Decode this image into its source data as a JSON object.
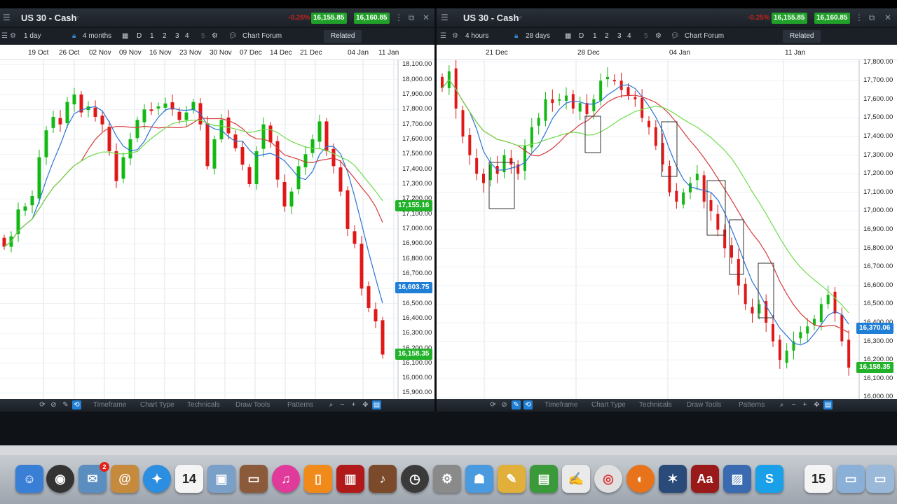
{
  "colors": {
    "bull": "#14b814",
    "bear": "#e01818",
    "ma_blue": "#2a74d6",
    "ma_red": "#d63a3a",
    "ma_green": "#6fdc4a",
    "badge_green": "#22b22a",
    "badge_blue": "#1f7fd6"
  },
  "left": {
    "title": "US 30 - Cash",
    "quote_change": "-0.26%",
    "quote_sell": "16,155.85",
    "quote_buy": "16,160.85",
    "toolbar": {
      "interval": "1 day",
      "range": "4 months",
      "zoom": [
        "D",
        "1",
        "2",
        "3",
        "4",
        "5"
      ],
      "forum": "Chart Forum",
      "related": "Related"
    },
    "dates": [
      "19 Oct",
      "26 Oct",
      "02 Nov",
      "09 Nov",
      "16 Nov",
      "23 Nov",
      "30 Nov",
      "07 Dec",
      "14 Dec",
      "21 Dec",
      "04 Jan",
      "11 Jan"
    ],
    "yticks": [
      "18,100.00",
      "18,000.00",
      "17,900.00",
      "17,800.00",
      "17,700.00",
      "17,600.00",
      "17,500.00",
      "17,400.00",
      "17,300.00",
      "17,200.00",
      "17,100.00",
      "17,000.00",
      "16,900.00",
      "16,800.00",
      "16,700.00",
      "16,600.00",
      "16,500.00",
      "16,400.00",
      "16,300.00",
      "16,200.00",
      "16,100.00",
      "16,000.00",
      "15,900.00"
    ],
    "badges": [
      {
        "label": "17,155.16",
        "value": 17155.16,
        "color": "green"
      },
      {
        "label": "16,603.75",
        "value": 16603.75,
        "color": "blue"
      },
      {
        "label": "16,158.35",
        "value": 16158.35,
        "color": "green"
      }
    ],
    "bottom": [
      "Timeframe",
      "Chart Type",
      "Technicals",
      "Draw Tools",
      "Patterns"
    ]
  },
  "right": {
    "title": "US 30 - Cash",
    "quote_change": "-0.25%",
    "quote_sell": "16,155.85",
    "quote_buy": "16,160.85",
    "toolbar": {
      "interval": "4 hours",
      "range": "28 days",
      "zoom": [
        "D",
        "1",
        "2",
        "3",
        "4",
        "5"
      ],
      "forum": "Chart Forum",
      "related": "Related"
    },
    "dates": [
      "21 Dec",
      "28 Dec",
      "04 Jan",
      "11 Jan"
    ],
    "yticks": [
      "17,800.00",
      "17,700.00",
      "17,600.00",
      "17,500.00",
      "17,400.00",
      "17,300.00",
      "17,200.00",
      "17,100.00",
      "17,000.00",
      "16,900.00",
      "16,800.00",
      "16,700.00",
      "16,600.00",
      "16,500.00",
      "16,400.00",
      "16,300.00",
      "16,200.00",
      "16,100.00",
      "16,000.00"
    ],
    "badges": [
      {
        "label": "16,370.06",
        "value": 16370.06,
        "color": "blue"
      },
      {
        "label": "16,158.35",
        "value": 16158.35,
        "color": "green"
      }
    ],
    "bottom": [
      "Timeframe",
      "Chart Type",
      "Technicals",
      "Draw Tools",
      "Patterns"
    ]
  },
  "chart_data": [
    {
      "type": "candlestick",
      "title": "US 30 - Cash",
      "interval": "1 day",
      "ylim": [
        15860,
        18130
      ],
      "x_labels": [
        "19 Oct",
        "26 Oct",
        "02 Nov",
        "09 Nov",
        "16 Nov",
        "23 Nov",
        "30 Nov",
        "07 Dec",
        "14 Dec",
        "21 Dec",
        "04 Jan",
        "11 Jan"
      ],
      "close": [
        16880,
        16950,
        17130,
        17150,
        17220,
        17480,
        17660,
        17750,
        17700,
        17850,
        17900,
        17780,
        17820,
        17750,
        17700,
        17520,
        17320,
        17480,
        17600,
        17730,
        17800,
        17790,
        17820,
        17840,
        17800,
        17730,
        17780,
        17850,
        17700,
        17420,
        17600,
        17730,
        17640,
        17540,
        17430,
        17300,
        17520,
        17700,
        17580,
        17330,
        17150,
        17250,
        17420,
        17500,
        17600,
        17720,
        17520,
        17420,
        17250,
        17000,
        16900,
        16600,
        16470,
        16380,
        16158
      ],
      "ma_blue_last": 16603.75,
      "ma_red_last": 17155.16,
      "last": 16158.35
    },
    {
      "type": "candlestick",
      "title": "US 30 - Cash",
      "interval": "4 hours",
      "ylim": [
        15990,
        17810
      ],
      "x_labels": [
        "21 Dec",
        "28 Dec",
        "04 Jan",
        "11 Jan"
      ],
      "close": [
        17660,
        17750,
        17550,
        17400,
        17300,
        17200,
        17150,
        17250,
        17200,
        17300,
        17250,
        17200,
        17350,
        17450,
        17500,
        17600,
        17580,
        17600,
        17620,
        17550,
        17580,
        17520,
        17600,
        17700,
        17720,
        17700,
        17650,
        17620,
        17600,
        17500,
        17450,
        17350,
        17250,
        17100,
        17050,
        17100,
        17150,
        17200,
        17050,
        17000,
        16900,
        16800,
        16750,
        16600,
        16500,
        16450,
        16500,
        16400,
        16300,
        16200,
        16250,
        16300,
        16350,
        16380,
        16420,
        16500,
        16550,
        16450,
        16300,
        16158
      ],
      "ma_blue_last": 16370.06,
      "last": 16158.35
    }
  ]
}
